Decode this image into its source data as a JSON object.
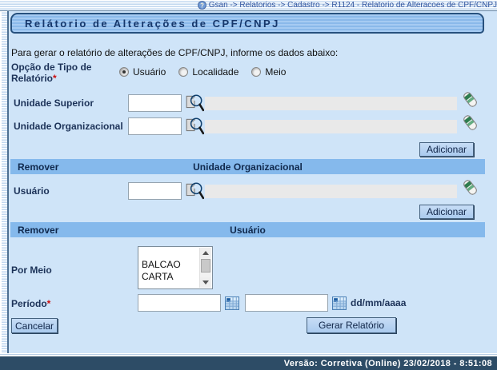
{
  "breadcrumb": {
    "text": "Gsan -> Relatorios -> Cadastro -> R1124 - Relatorio de Alteracoes de CPF/CNPJ"
  },
  "title": "Relátorio de Alterações de CPF/CNPJ",
  "intro": "Para gerar o relatório de alterações de CPF/CNPJ, informe os dados abaixo:",
  "report_type": {
    "label": "Opção de Tipo de Relatório",
    "required_mark": "*",
    "options": [
      {
        "label": "Usuário",
        "selected": true
      },
      {
        "label": "Localidade",
        "selected": false
      },
      {
        "label": "Meio",
        "selected": false
      }
    ]
  },
  "fields": {
    "unidade_superior": {
      "label": "Unidade Superior",
      "value": "",
      "display_value": ""
    },
    "unidade_organizacional": {
      "label": "Unidade Organizacional",
      "value": "",
      "display_value": ""
    },
    "usuario": {
      "label": "Usuário",
      "value": "",
      "display_value": ""
    }
  },
  "tables": [
    {
      "remover": "Remover",
      "col_title": "Unidade Organizacional"
    },
    {
      "remover": "Remover",
      "col_title": "Usuário"
    }
  ],
  "por_meio": {
    "label": "Por Meio",
    "options": [
      "",
      "BALCAO",
      "CARTA"
    ]
  },
  "periodo": {
    "label": "Período",
    "required_mark": "*",
    "start_value": "",
    "end_value": "",
    "format_hint": "dd/mm/aaaa"
  },
  "buttons": {
    "adicionar": "Adicionar",
    "cancelar": "Cancelar",
    "gerar": "Gerar Relatório"
  },
  "footer": {
    "text": "Versão: Corretiva (Online) 23/02/2018 - 8:51:08"
  },
  "icons": {
    "help": "help-icon",
    "search": "search-icon",
    "eraser": "eraser-icon",
    "calendar": "calendar-icon",
    "scroll_up": "scroll-up-icon",
    "scroll_down": "scroll-down-icon"
  },
  "colors": {
    "content_bg": "#cfe4f8",
    "table_header_bg": "#85b9ec",
    "title_border": "#27517e",
    "footer_bg": "#2d4c66",
    "button_bg": "#aacaee",
    "required": "#cc1111"
  }
}
